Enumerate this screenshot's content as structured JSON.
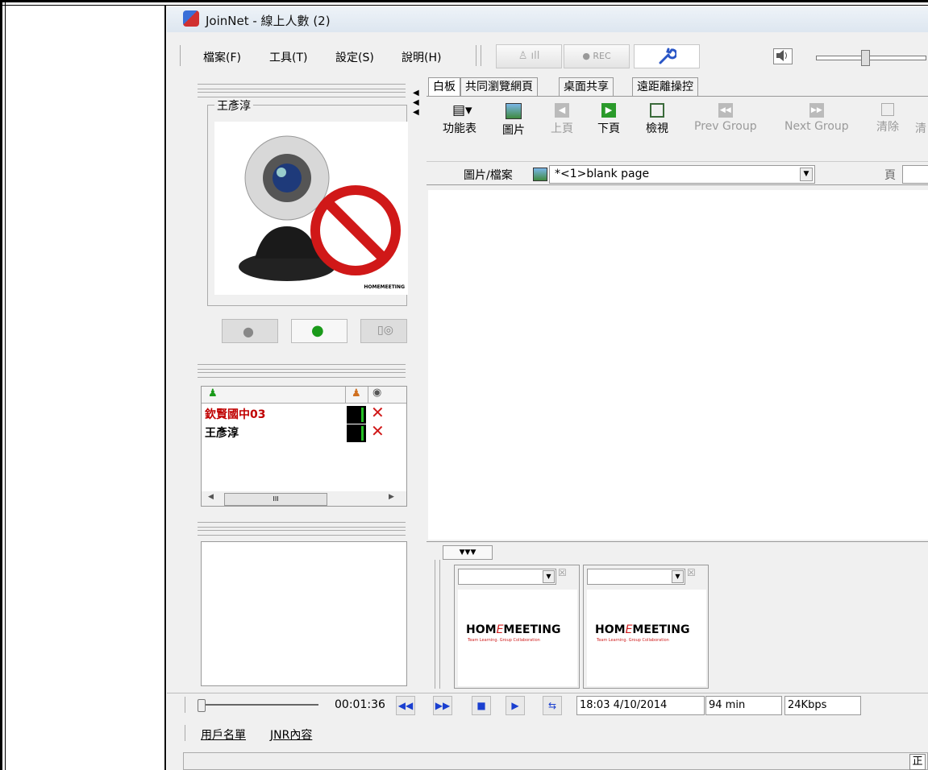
{
  "window": {
    "title": "JoinNet - 線上人數 (2)"
  },
  "menu": [
    "檔案(F)",
    "工具(T)",
    "設定(S)",
    "說明(H)"
  ],
  "toolbar": {
    "rec_label": "● REC"
  },
  "video": {
    "user_name": "王彥淳",
    "logo_text": "HOMEMEETING"
  },
  "users_list": {
    "rows": [
      {
        "name": "欽賢國中03",
        "color": "#c00000"
      },
      {
        "name": "王彥淳",
        "color": "#000000"
      }
    ],
    "scroll_mark": "III"
  },
  "tabs": [
    "白板",
    "共同瀏覽網頁",
    "桌面共享",
    "遠距離操控"
  ],
  "tools": [
    "功能表",
    "圖片",
    "上頁",
    "下頁",
    "檢視",
    "Prev Group",
    "Next Group",
    "清除",
    "清"
  ],
  "file_bar": {
    "label": "圖片/檔案",
    "value": "*<1>blank page",
    "page_label": "頁"
  },
  "thumbnails": [
    {
      "logo": "HOMEMEETING",
      "tagline": "Team Learning. Group Collaboration"
    },
    {
      "logo": "HOMEMEETING",
      "tagline": "Team Learning. Group Collaboration"
    }
  ],
  "playback": {
    "elapsed": "00:01:36",
    "datetime": "18:03 4/10/2014",
    "duration": "94 min",
    "bitrate": "24Kbps"
  },
  "bottom_tabs": [
    "用戶名單",
    "JNR內容"
  ],
  "status": {
    "corner_text": "正"
  },
  "colors": {
    "accent_blue": "#1a3fd0",
    "red": "#c00000",
    "green": "#1a9a1a"
  }
}
